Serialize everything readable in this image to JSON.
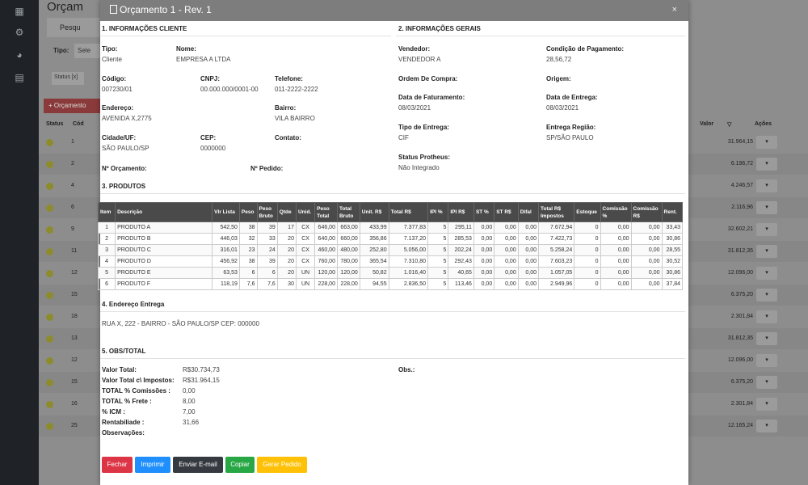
{
  "background": {
    "title": "Orçam",
    "search_label": "Pesqu",
    "tipo_label": "Tipo:",
    "select_value": "Sele",
    "chip": "Status [x]",
    "new_button": "+ Orçamento",
    "columns": {
      "status": "Status",
      "cod": "Cód",
      "valor": "Valor",
      "acoes": "Ações"
    },
    "rows": [
      {
        "code": "1",
        "value": "31.964,15"
      },
      {
        "code": "2",
        "value": "6.196,72"
      },
      {
        "code": "4",
        "value": "4.246,57"
      },
      {
        "code": "6",
        "value": "2.116,96"
      },
      {
        "code": "9",
        "value": "32.602,21"
      },
      {
        "code": "11",
        "value": "31.812,35"
      },
      {
        "code": "12",
        "value": "12.096,00"
      },
      {
        "code": "15",
        "value": "6.375,20"
      },
      {
        "code": "18",
        "value": "2.301,84"
      },
      {
        "code": "13",
        "value": "31.812,35"
      },
      {
        "code": "12",
        "value": "12.096,00"
      },
      {
        "code": "15",
        "value": "6.375,20"
      },
      {
        "code": "16",
        "value": "2.301,84"
      },
      {
        "code": "25",
        "value": "12.165,24"
      }
    ]
  },
  "modal": {
    "title": "Orçamento 1 - Rev. 1",
    "close": "×",
    "cliente": {
      "section": "1. INFORMAÇÕES CLIENTE",
      "tipo_label": "Tipo:",
      "tipo": "Cliente",
      "nome_label": "Nome:",
      "nome": "EMPRESA A LTDA",
      "codigo_label": "Código:",
      "codigo": "007230/01",
      "cnpj_label": "CNPJ:",
      "cnpj": "00.000.000/0001-00",
      "telefone_label": "Telefone:",
      "telefone": "011-2222-2222",
      "endereco_label": "Endereço:",
      "endereco": "AVENIDA X,2775",
      "bairro_label": "Bairro:",
      "bairro": "VILA BAIRRO",
      "cidade_label": "Cidade/UF:",
      "cidade": "SÃO PAULO/SP",
      "cep_label": "CEP:",
      "cep": "0000000",
      "contato_label": "Contato:",
      "num_orcamento_label": "Nº Orçamento:",
      "num_pedido_label": "Nº Pedido:"
    },
    "gerais": {
      "section": "2. INFORMAÇÕES GERAIS",
      "vendedor_label": "Vendedor:",
      "vendedor": "VENDEDOR A",
      "condicao_label": "Condição de Pagamento:",
      "condicao": "28,56,72",
      "ordem_label": "Ordem De Compra:",
      "origem_label": "Origem:",
      "faturamento_label": "Data de Faturamento:",
      "faturamento": "08/03/2021",
      "entrega_label": "Data de Entrega:",
      "entrega": "08/03/2021",
      "tipo_entrega_label": "Tipo de Entrega:",
      "tipo_entrega": "CIF",
      "regiao_label": "Entrega Região:",
      "regiao": "SP/SÃO PAULO",
      "protheus_label": "Status Protheus:",
      "protheus": "Não Integrado"
    },
    "produtos": {
      "section": "3. PRODUTOS",
      "headers": [
        "Item",
        "Descrição",
        "Vlr Lista",
        "Peso",
        "Peso Bruto",
        "Qtde",
        "Unid.",
        "Peso Total",
        "Total Bruto",
        "Unit. R$",
        "Total R$",
        "IPI %",
        "IPI R$",
        "ST %",
        "ST R$",
        "Difal",
        "Total R$ Impostos",
        "Estoque",
        "Comissão %",
        "Comissão R$",
        "Rent."
      ],
      "rows": [
        [
          "1",
          "PRODUTO A",
          "542,50",
          "38",
          "39",
          "17",
          "CX",
          "646,00",
          "663,00",
          "433,99",
          "7.377,83",
          "5",
          "295,11",
          "0,00",
          "0,00",
          "0,00",
          "7.672,94",
          "0",
          "0,00",
          "0,00",
          "33,43"
        ],
        [
          "2",
          "PRODUTO B",
          "446,03",
          "32",
          "33",
          "20",
          "CX",
          "640,00",
          "660,00",
          "356,86",
          "7.137,20",
          "5",
          "285,53",
          "0,00",
          "0,00",
          "0,00",
          "7.422,73",
          "0",
          "0,00",
          "0,00",
          "30,86"
        ],
        [
          "3",
          "PRODUTO C",
          "316,01",
          "23",
          "24",
          "20",
          "CX",
          "460,00",
          "480,00",
          "252,80",
          "5.056,00",
          "5",
          "202,24",
          "0,00",
          "0,00",
          "0,00",
          "5.258,24",
          "0",
          "0,00",
          "0,00",
          "28,55"
        ],
        [
          "4",
          "PRODUTO D",
          "456,92",
          "38",
          "39",
          "20",
          "CX",
          "760,00",
          "780,00",
          "365,54",
          "7.310,80",
          "5",
          "292,43",
          "0,00",
          "0,00",
          "0,00",
          "7.603,23",
          "0",
          "0,00",
          "0,00",
          "30,52"
        ],
        [
          "5",
          "PRODUTO E",
          "63,53",
          "6",
          "6",
          "20",
          "UN",
          "120,00",
          "120,00",
          "50,82",
          "1.016,40",
          "5",
          "40,65",
          "0,00",
          "0,00",
          "0,00",
          "1.057,05",
          "0",
          "0,00",
          "0,00",
          "30,86"
        ],
        [
          "6",
          "PRODUTO F",
          "118,19",
          "7,6",
          "7,6",
          "30",
          "UN",
          "228,00",
          "228,00",
          "94,55",
          "2.836,50",
          "5",
          "113,46",
          "0,00",
          "0,00",
          "0,00",
          "2.949,96",
          "0",
          "0,00",
          "0,00",
          "37,84"
        ]
      ]
    },
    "endereco_entrega": {
      "section": "4. Endereço Entrega",
      "text": "RUA X, 222 - BAIRRO - SÃO PAULO/SP CEP: 000000"
    },
    "obs_total": {
      "section": "5. OBS/TOTAL",
      "valor_total_label": "Valor Total:",
      "valor_total": "R$30.734,73",
      "valor_impostos_label": "Valor Total c\\ Impostos:",
      "valor_impostos": "R$31.964,15",
      "comissoes_label": "TOTAL % Comissões :",
      "comissoes": "0,00",
      "frete_label": "TOTAL % Frete :",
      "frete": "8,00",
      "icm_label": "% ICM :",
      "icm": "7,00",
      "rentabilidade_label": "Rentabiliade :",
      "rentabilidade": "31,66",
      "observacoes_label": "Observações:",
      "obs_label": "Obs.:"
    },
    "buttons": {
      "fechar": "Fechar",
      "imprimir": "Imprimir",
      "email": "Enviar E-mail",
      "copiar": "Copiar",
      "gerar": "Gerar Pedido"
    }
  }
}
